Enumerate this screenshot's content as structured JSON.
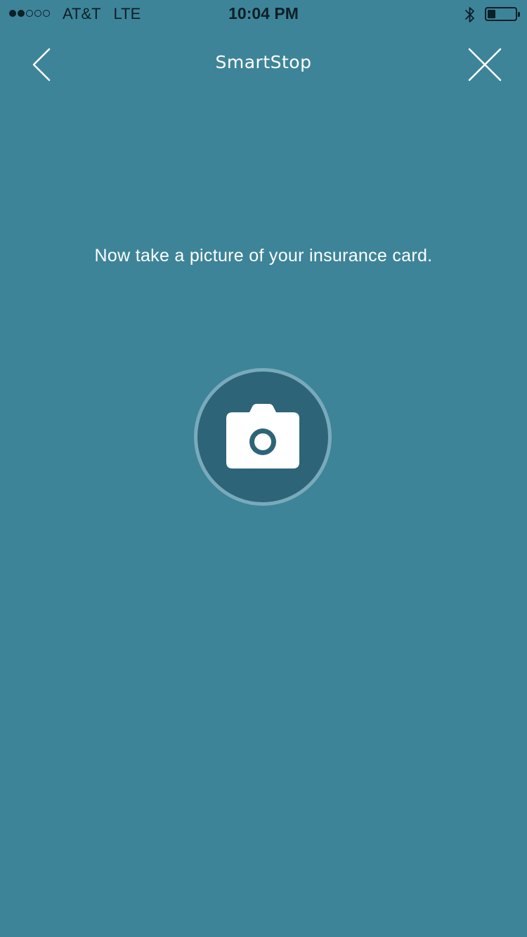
{
  "status_bar": {
    "signal_filled": 2,
    "signal_total": 5,
    "carrier": "AT&T   LTE",
    "time": "10:04 PM",
    "battery_level": 0.3
  },
  "header": {
    "title": "SmartStop",
    "back_icon": "chevron-left-icon",
    "close_icon": "close-icon"
  },
  "main": {
    "prompt": "Now take a picture of your insurance card.",
    "camera_icon": "camera-icon"
  },
  "colors": {
    "background": "#3d8499",
    "camera_circle": "#2d6478",
    "camera_ring": "#79aabb",
    "text": "#ffffff",
    "status_text": "#0d1f27"
  }
}
